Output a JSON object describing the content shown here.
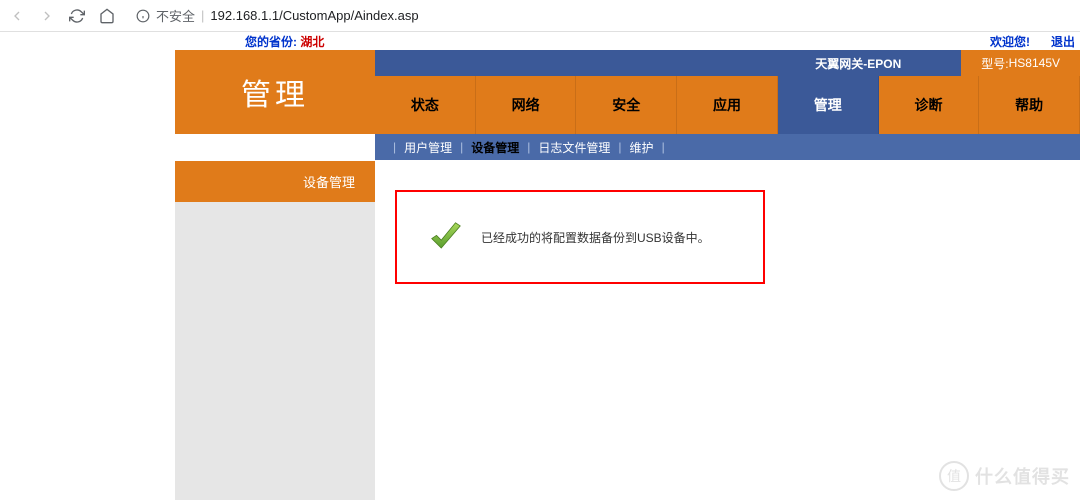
{
  "browser": {
    "security": "不安全",
    "url": "192.168.1.1/CustomApp/Aindex.asp"
  },
  "topbar": {
    "province_label": "您的省份:",
    "province_value": "湖北",
    "welcome": "欢迎您!",
    "logout": "退出"
  },
  "header": {
    "title": "管理",
    "gateway": "天翼网关-EPON",
    "model_label": "型号:",
    "model_value": "HS8145V"
  },
  "nav": {
    "tabs": [
      "状态",
      "网络",
      "安全",
      "应用",
      "管理",
      "诊断",
      "帮助"
    ],
    "active": 4
  },
  "subnav": {
    "items": [
      "用户管理",
      "设备管理",
      "日志文件管理",
      "维护"
    ],
    "active": 1
  },
  "sidebar": {
    "title": "设备管理"
  },
  "message": {
    "text": "已经成功的将配置数据备份到USB设备中。"
  },
  "watermark": {
    "badge": "值",
    "text": "什么值得买"
  }
}
